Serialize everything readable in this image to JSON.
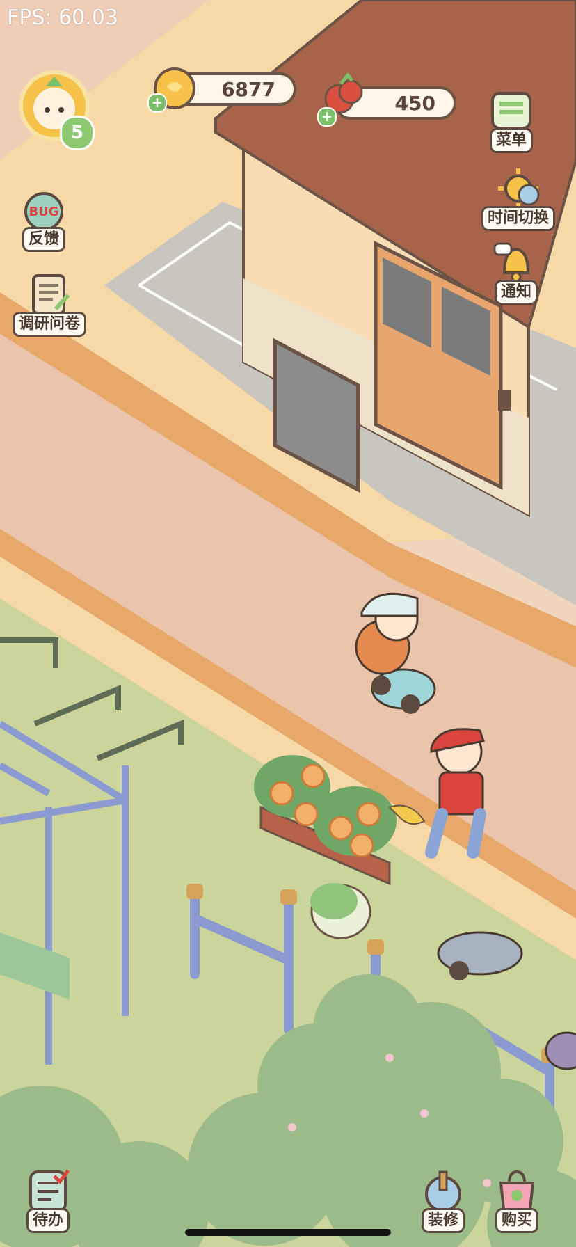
{
  "fps": "FPS: 60.03",
  "player": {
    "level": "5"
  },
  "currency": {
    "coins": "6877",
    "produce": "450"
  },
  "left_buttons": {
    "feedback": "反馈",
    "survey": "调研问卷",
    "todo": "待办"
  },
  "right_buttons": {
    "menu": "菜单",
    "time_switch": "时间切换",
    "notice": "通知"
  },
  "bottom_buttons": {
    "decorate": "装修",
    "buy": "购买"
  },
  "icons": [
    "carrot-avatar-icon",
    "coin-icon",
    "tomato-icon",
    "menu-icon",
    "sun-icon",
    "bell-icon",
    "bug-icon",
    "survey-icon",
    "todo-icon",
    "decorate-icon",
    "buy-icon"
  ],
  "colors": {
    "pill_border": "#6b5446",
    "pill_bg": "#fff6e9",
    "plus": "#7cbf6a",
    "grass": "#cbd49a"
  }
}
